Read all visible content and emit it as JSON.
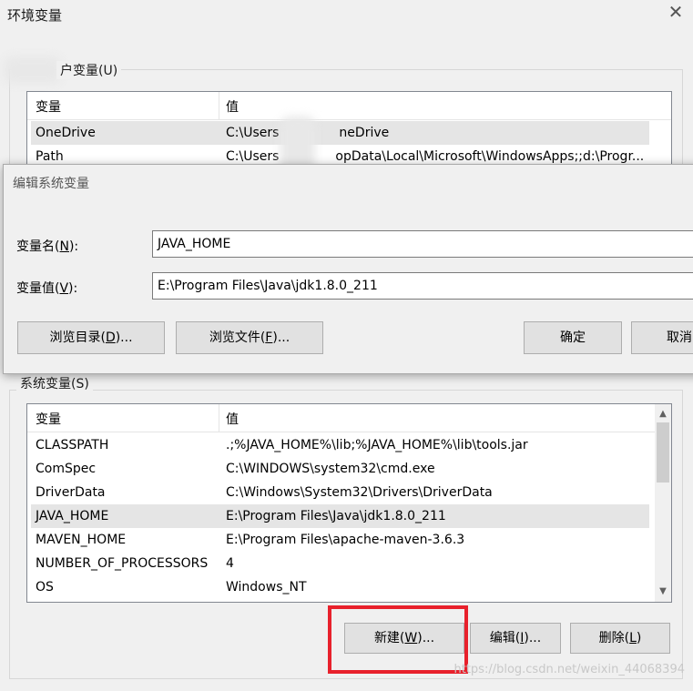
{
  "window": {
    "title": "环境变量",
    "close_glyph": "✕"
  },
  "user_vars": {
    "group_title": "户变量(U)",
    "col_name": "变量",
    "col_value": "值",
    "rows": [
      {
        "name": "OneDrive",
        "value": "C:\\Users\\██████OneDrive",
        "value_left": "C:\\Users",
        "value_right": "neDrive"
      },
      {
        "name": "Path",
        "value": "C:\\Users\\██████ppData\\Local\\Microsoft\\WindowsApps;;d:\\Progr...",
        "value_left": "C:\\Users",
        "value_right": "opData\\Local\\Microsoft\\WindowsApps;;d:\\Progr..."
      }
    ]
  },
  "edit_dialog": {
    "title": "编辑系统变量",
    "name_label": "变量名(",
    "name_key": "N",
    "name_label_end": "):",
    "value_label": "变量值(",
    "value_key": "V",
    "value_label_end": "):",
    "name_value": "JAVA_HOME",
    "value_value": "E:\\Program Files\\Java\\jdk1.8.0_211",
    "browse_dir_pre": "浏览目录(",
    "browse_dir_key": "D",
    "browse_dir_post": ")...",
    "browse_file_pre": "浏览文件(",
    "browse_file_key": "F",
    "browse_file_post": ")...",
    "ok_label": "确定",
    "cancel_label": "取消"
  },
  "system_vars": {
    "group_title": "系统变量(S)",
    "col_name": "变量",
    "col_value": "值",
    "rows": [
      {
        "name": "CLASSPATH",
        "value": ".;%JAVA_HOME%\\lib;%JAVA_HOME%\\lib\\tools.jar"
      },
      {
        "name": "ComSpec",
        "value": "C:\\WINDOWS\\system32\\cmd.exe"
      },
      {
        "name": "DriverData",
        "value": "C:\\Windows\\System32\\Drivers\\DriverData"
      },
      {
        "name": "JAVA_HOME",
        "value": "E:\\Program Files\\Java\\jdk1.8.0_211"
      },
      {
        "name": "MAVEN_HOME",
        "value": "E:\\Program Files\\apache-maven-3.6.3"
      },
      {
        "name": "NUMBER_OF_PROCESSORS",
        "value": "4"
      },
      {
        "name": "OS",
        "value": "Windows_NT"
      }
    ],
    "selected_index": 3,
    "new_pre": "新建(",
    "new_key": "W",
    "new_post": ")...",
    "edit_pre": "编辑(",
    "edit_key": "I",
    "edit_post": ")...",
    "delete_pre": "删除(",
    "delete_key": "L",
    "delete_post": ")"
  },
  "icons": {
    "close": "close-icon",
    "scroll_up": "scroll-up-arrow-icon",
    "scroll_down": "scroll-down-arrow-icon"
  },
  "colors": {
    "highlight_box": "#e8212c",
    "selected_row": "#e5e5e5"
  },
  "watermark": "https://blog.csdn.net/weixin_44068394"
}
